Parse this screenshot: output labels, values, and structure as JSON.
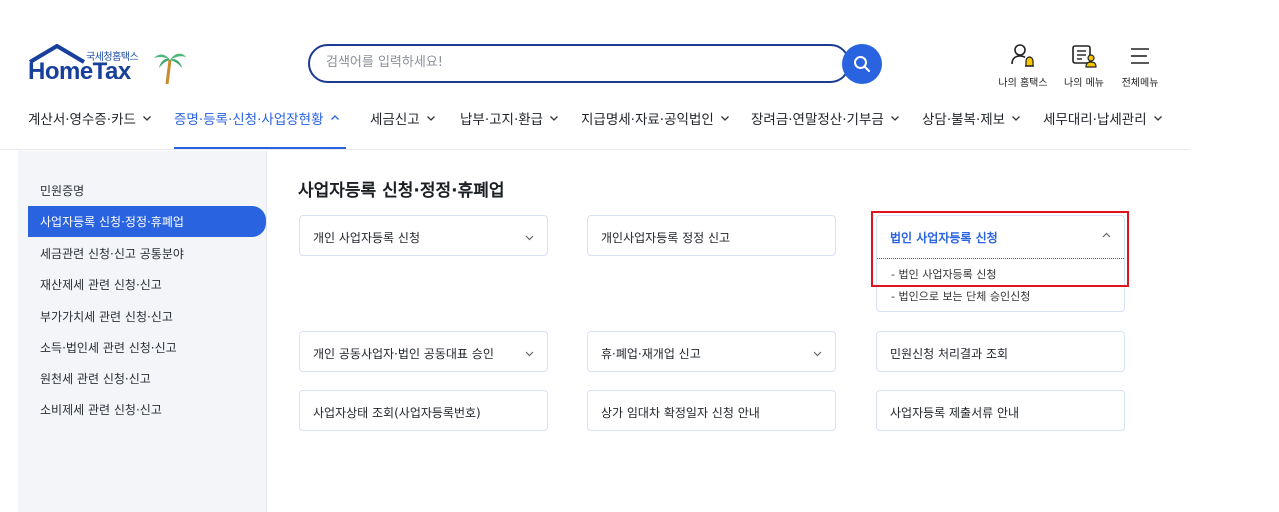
{
  "logo": {
    "sub": "국세청홈택스",
    "main": "HomeTax"
  },
  "search": {
    "placeholder": "검색어를 입력하세요!"
  },
  "utils": [
    {
      "label": "나의 홈택스",
      "icon": "user-bell-icon"
    },
    {
      "label": "나의 메뉴",
      "icon": "my-menu-icon"
    },
    {
      "label": "전체메뉴",
      "icon": "hamburger-icon"
    }
  ],
  "gnb": [
    {
      "label": "계산서·영수증·카드"
    },
    {
      "label": "증명·등록·신청·사업장현황"
    },
    {
      "label": "세금신고"
    },
    {
      "label": "납부·고지·환급"
    },
    {
      "label": "지급명세·자료·공익법인"
    },
    {
      "label": "장려금·연말정산·기부금"
    },
    {
      "label": "상담·불복·제보"
    },
    {
      "label": "세무대리·납세관리"
    }
  ],
  "sidebar": {
    "items": [
      {
        "label": "민원증명"
      },
      {
        "label": "사업자등록 신청·정정·휴폐업"
      },
      {
        "label": "세금관련 신청·신고 공통분야"
      },
      {
        "label": "재산제세 관련 신청·신고"
      },
      {
        "label": "부가가치세 관련 신청·신고"
      },
      {
        "label": "소득·법인세 관련 신청·신고"
      },
      {
        "label": "원천세 관련 신청·신고"
      },
      {
        "label": "소비제세 관련 신청·신고"
      }
    ]
  },
  "main": {
    "title": "사업자등록 신청·정정·휴폐업",
    "cards": [
      {
        "label": "개인 사업자등록 신청"
      },
      {
        "label": "개인사업자등록 정정 신고"
      },
      {
        "label": "개인 공동사업자·법인 공동대표 승인"
      },
      {
        "label": "휴·폐업·재개업 신고"
      },
      {
        "label": "민원신청 처리결과 조회"
      },
      {
        "label": "사업자상태 조회(사업자등록번호)"
      },
      {
        "label": "상가 임대차 확정일자 신청 안내"
      },
      {
        "label": "사업자등록 제출서류 안내"
      }
    ],
    "dropdown": {
      "label": "법인 사업자등록 신청",
      "items": [
        {
          "label": "- 법인 사업자등록 신청"
        },
        {
          "label": "- 법인으로 보는 단체 승인신청"
        }
      ]
    }
  }
}
